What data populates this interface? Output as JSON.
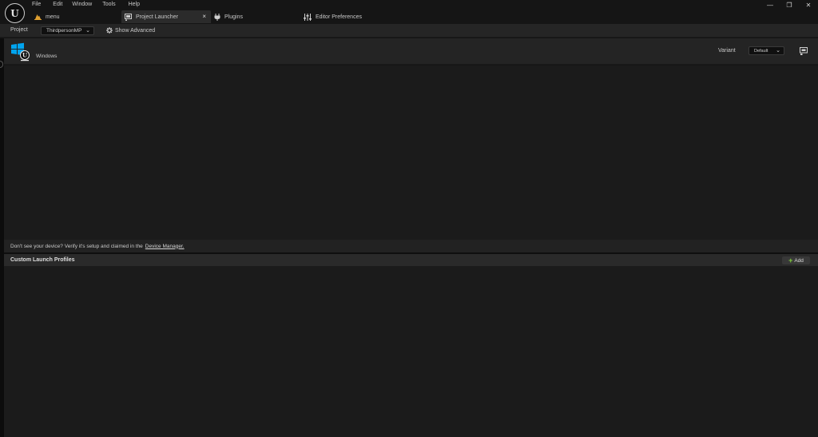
{
  "menu": [
    "File",
    "Edit",
    "Window",
    "Tools",
    "Help"
  ],
  "tabs": [
    {
      "label": "menu",
      "icon": "level-icon"
    },
    {
      "label": "Project Launcher",
      "icon": "launcher-icon",
      "active": true,
      "close": "×"
    },
    {
      "label": "Plugins",
      "icon": "plug-icon"
    },
    {
      "label": "Editor Preferences",
      "icon": "sliders-icon"
    }
  ],
  "window_controls": {
    "minimize": "—",
    "restore": "❐",
    "close": "✕"
  },
  "toolbar": {
    "project_label": "Project",
    "project_value": "ThirdpersonMP",
    "show_advanced": "Show Advanced"
  },
  "device": {
    "platform": "Windows",
    "variant_label": "Variant",
    "variant_value": "Default"
  },
  "hint": {
    "text": "Don't see your device? Verify it's setup and claimed in the",
    "link": "Device Manager."
  },
  "profiles": {
    "title": "Custom Launch Profiles",
    "add_label": "Add"
  },
  "colors": {
    "background": "#151515",
    "panel": "#1b1b1b",
    "accent_green": "#7ecb3b",
    "windows_blue": "#00a4ef",
    "level_orange": "#e0a030"
  }
}
